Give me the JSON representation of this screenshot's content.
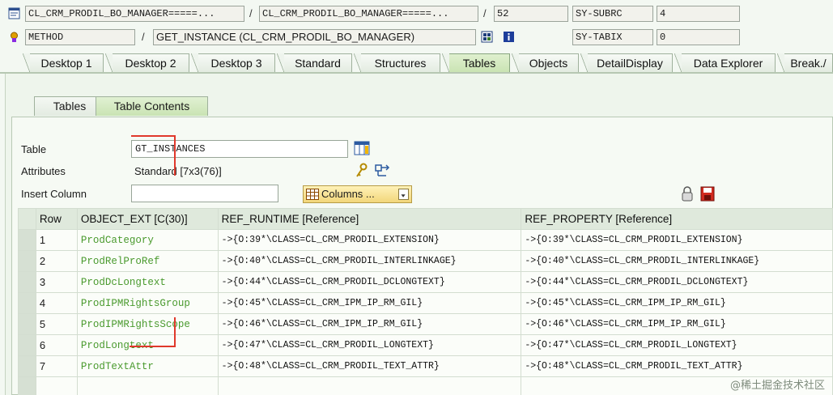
{
  "header": {
    "row1": {
      "program": "CL_CRM_PRODIL_BO_MANAGER=====...",
      "include": "CL_CRM_PRODIL_BO_MANAGER=====...",
      "line": "52",
      "sysvar_name": "SY-SUBRC",
      "sysvar_value": "4"
    },
    "row2": {
      "event_type": "METHOD",
      "event_name": "GET_INSTANCE (CL_CRM_PRODIL_BO_MANAGER)",
      "sysvar_name": "SY-TABIX",
      "sysvar_value": "0"
    },
    "separator": "/"
  },
  "main_tabs": [
    "Desktop 1",
    "Desktop 2",
    "Desktop 3",
    "Standard",
    "Structures",
    "Tables",
    "Objects",
    "DetailDisplay",
    "Data Explorer",
    "Break./"
  ],
  "active_main_tab": "Tables",
  "sub_tabs": [
    "Tables",
    "Table Contents"
  ],
  "active_sub_tab": "Table Contents",
  "form": {
    "table_label": "Table",
    "table_value": "GT_INSTANCES",
    "attributes_label": "Attributes",
    "attributes_value": "Standard [7x3(76)]",
    "insert_column_label": "Insert Column",
    "insert_column_value": "",
    "columns_button": "Columns ..."
  },
  "grid": {
    "columns": [
      "Row",
      "OBJECT_EXT [C(30)]",
      "REF_RUNTIME [Reference]",
      "REF_PROPERTY [Reference]"
    ],
    "rows": [
      {
        "row": "1",
        "object_ext": "ProdCategory",
        "ref_runtime": "->{O:39*\\CLASS=CL_CRM_PRODIL_EXTENSION}",
        "ref_property": "->{O:39*\\CLASS=CL_CRM_PRODIL_EXTENSION}"
      },
      {
        "row": "2",
        "object_ext": "ProdRelProRef",
        "ref_runtime": "->{O:40*\\CLASS=CL_CRM_PRODIL_INTERLINKAGE}",
        "ref_property": "->{O:40*\\CLASS=CL_CRM_PRODIL_INTERLINKAGE}"
      },
      {
        "row": "3",
        "object_ext": "ProdDcLongtext",
        "ref_runtime": "->{O:44*\\CLASS=CL_CRM_PRODIL_DCLONGTEXT}",
        "ref_property": "->{O:44*\\CLASS=CL_CRM_PRODIL_DCLONGTEXT}"
      },
      {
        "row": "4",
        "object_ext": "ProdIPMRightsGroup",
        "ref_runtime": "->{O:45*\\CLASS=CL_CRM_IPM_IP_RM_GIL}",
        "ref_property": "->{O:45*\\CLASS=CL_CRM_IPM_IP_RM_GIL}"
      },
      {
        "row": "5",
        "object_ext": "ProdIPMRightsScope",
        "ref_runtime": "->{O:46*\\CLASS=CL_CRM_IPM_IP_RM_GIL}",
        "ref_property": "->{O:46*\\CLASS=CL_CRM_IPM_IP_RM_GIL}"
      },
      {
        "row": "6",
        "object_ext": "ProdLongtext",
        "ref_runtime": "->{O:47*\\CLASS=CL_CRM_PRODIL_LONGTEXT}",
        "ref_property": "->{O:47*\\CLASS=CL_CRM_PRODIL_LONGTEXT}"
      },
      {
        "row": "7",
        "object_ext": "ProdTextAttr",
        "ref_runtime": "->{O:48*\\CLASS=CL_CRM_PRODIL_TEXT_ATTR}",
        "ref_property": "->{O:48*\\CLASS=CL_CRM_PRODIL_TEXT_ATTR}"
      }
    ],
    "empty_rows": 1
  },
  "watermark": "@稀土掘金技术社区",
  "icons": [
    "program-icon",
    "method-icon",
    "source-icon",
    "info-icon",
    "table-display-icon",
    "attributes-icon",
    "service-icon",
    "lock-icon",
    "save-icon",
    "dropdown-icon"
  ],
  "colors": {
    "object_text": "#4a9a2e",
    "active_tab": "#c9e3b2",
    "annotation": "#e0382b",
    "columns_button": "#f2d67a"
  }
}
